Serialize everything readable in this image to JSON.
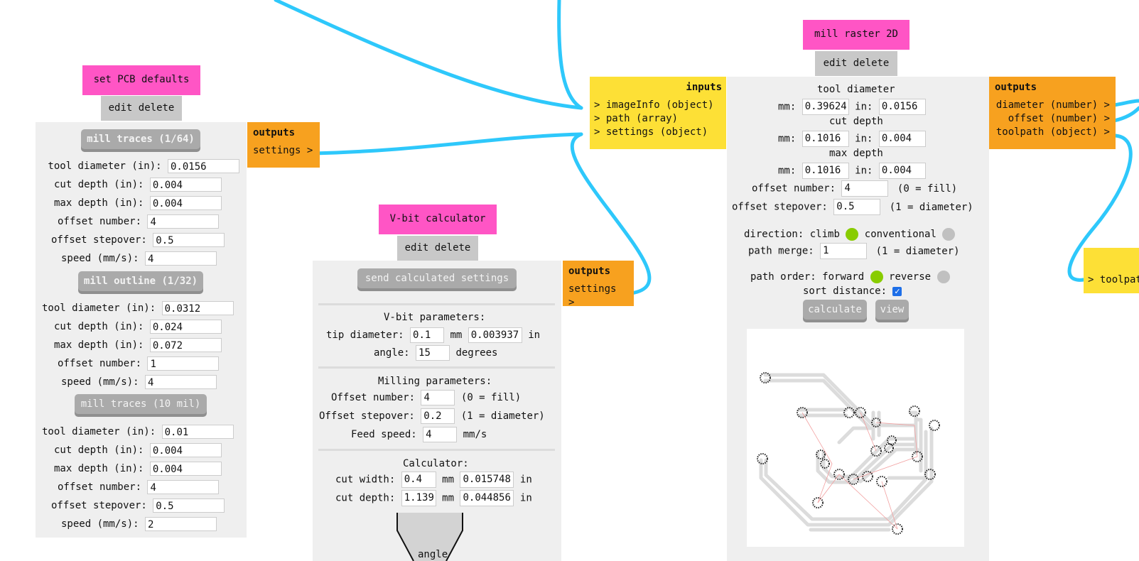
{
  "colors": {
    "wire": "#2ec8fb",
    "title_bg": "#ff55c5",
    "outputs_bg": "#f7a11f",
    "inputs_bg": "#fde036",
    "panel_bg": "#efefef",
    "button_bg": "#aaaaaa",
    "radio_on": "#88cc00",
    "radio_off": "#c0c0c0"
  },
  "pcb_defaults": {
    "title": "set PCB defaults",
    "edit": "edit",
    "delete": "delete",
    "outputs_label": "outputs",
    "outputs": [
      "settings >"
    ],
    "sections": [
      {
        "button": "mill traces (1/64)",
        "fields": [
          {
            "label": "tool diameter (in):",
            "value": "0.0156"
          },
          {
            "label": "cut depth (in):",
            "value": "0.004"
          },
          {
            "label": "max depth (in):",
            "value": "0.004"
          },
          {
            "label": "offset number:",
            "value": "4"
          },
          {
            "label": "offset stepover:",
            "value": "0.5"
          },
          {
            "label": "speed (mm/s):",
            "value": "4"
          }
        ]
      },
      {
        "button": "mill outline (1/32)",
        "fields": [
          {
            "label": "tool diameter (in):",
            "value": "0.0312"
          },
          {
            "label": "cut depth (in):",
            "value": "0.024"
          },
          {
            "label": "max depth (in):",
            "value": "0.072"
          },
          {
            "label": "offset number:",
            "value": "1"
          },
          {
            "label": "speed (mm/s):",
            "value": "4"
          }
        ]
      },
      {
        "button": "mill traces (10 mil)",
        "fields": [
          {
            "label": "tool diameter (in):",
            "value": "0.01"
          },
          {
            "label": "cut depth (in):",
            "value": "0.004"
          },
          {
            "label": "max depth (in):",
            "value": "0.004"
          },
          {
            "label": "offset number:",
            "value": "4"
          },
          {
            "label": "offset stepover:",
            "value": "0.5"
          },
          {
            "label": "speed (mm/s):",
            "value": "2"
          }
        ]
      }
    ]
  },
  "vbit": {
    "title": "V-bit calculator",
    "edit": "edit",
    "delete": "delete",
    "send_button": "send calculated settings",
    "outputs_label": "outputs",
    "outputs": [
      "settings >"
    ],
    "vbit_heading": "V-bit parameters:",
    "tip_label": "tip diameter:",
    "tip_mm": "0.1",
    "tip_in": "0.003937",
    "angle_label": "angle:",
    "angle_value": "15",
    "unit_mm": "mm",
    "unit_in": "in",
    "unit_degrees": "degrees",
    "milling_heading": "Milling parameters:",
    "offset_number_label": "Offset number:",
    "offset_number": "4",
    "offset_number_note": "(0 = fill)",
    "offset_stepover_label": "Offset stepover:",
    "offset_stepover": "0.2",
    "offset_stepover_note": "(1 = diameter)",
    "feed_label": "Feed speed:",
    "feed_value": "4",
    "feed_unit": "mm/s",
    "calc_heading": "Calculator:",
    "cut_width_label": "cut width:",
    "cut_width_mm": "0.4",
    "cut_width_in": "0.015748",
    "cut_depth_label": "cut depth:",
    "cut_depth_mm": "1.139",
    "cut_depth_in": "0.044856",
    "diagram_label": "angle"
  },
  "mill_raster": {
    "title": "mill raster 2D",
    "edit": "edit",
    "delete": "delete",
    "inputs_label": "inputs",
    "inputs": [
      "> imageInfo (object)",
      "> path (array)",
      "> settings (object)"
    ],
    "outputs_label": "outputs",
    "outputs": [
      "diameter (number) >",
      "offset (number) >",
      "toolpath (object) >"
    ],
    "tool_diameter_heading": "tool diameter",
    "tool_mm": "0.39624",
    "tool_in": "0.0156",
    "cut_depth_heading": "cut depth",
    "cut_mm": "0.1016",
    "cut_in": "0.004",
    "max_depth_heading": "max depth",
    "max_mm": "0.1016",
    "max_in": "0.004",
    "mm_label": "mm:",
    "in_label": "in:",
    "offset_number_label": "offset number:",
    "offset_number": "4",
    "offset_number_note": "(0 = fill)",
    "offset_stepover_label": "offset stepover:",
    "offset_stepover": "0.5",
    "offset_stepover_note": "(1 = diameter)",
    "direction_label": "direction:",
    "direction_climb": "climb",
    "direction_conventional": "conventional",
    "direction_selected": "climb",
    "path_merge_label": "path merge:",
    "path_merge": "1",
    "path_merge_note": "(1 = diameter)",
    "path_order_label": "path order:",
    "path_order_forward": "forward",
    "path_order_reverse": "reverse",
    "path_order_selected": "forward",
    "sort_distance_label": "sort distance:",
    "sort_distance_checked": true,
    "calculate_button": "calculate",
    "view_button": "view"
  },
  "partial_node": {
    "inputs": [
      "> toolpat"
    ]
  }
}
